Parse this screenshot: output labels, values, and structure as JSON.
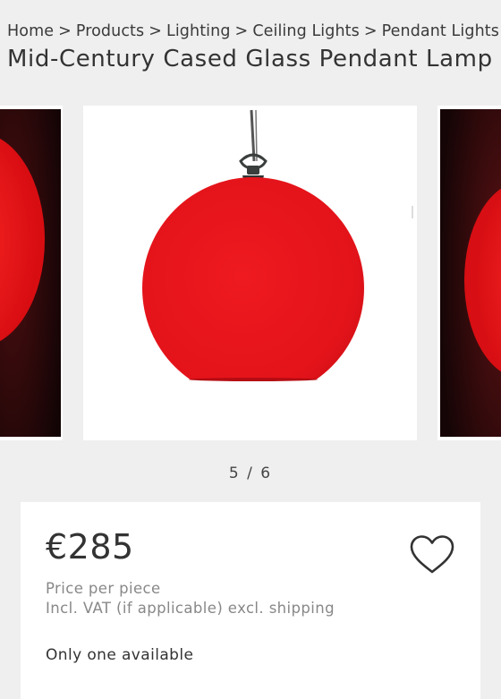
{
  "breadcrumb": {
    "items": [
      "Home",
      "Products",
      "Lighting",
      "Ceiling Lights",
      "Pendant Lights"
    ],
    "separator": ">"
  },
  "product": {
    "title": "Mid-Century Cased Glass Pendant Lamp"
  },
  "gallery": {
    "counter": "5 / 6",
    "current_index": 5,
    "total": 6,
    "image_semantics": "red-glass-globe-pendant-lamp"
  },
  "purchase": {
    "price": "€285",
    "price_per": "Price per piece",
    "vat_note": "Incl. VAT (if applicable) excl. shipping",
    "availability": "Only one available",
    "favorite_icon": "heart-outline-icon"
  },
  "colors": {
    "background": "#efefef",
    "card": "#ffffff",
    "lamp_red": "#e8141c",
    "muted_text": "#888888"
  }
}
